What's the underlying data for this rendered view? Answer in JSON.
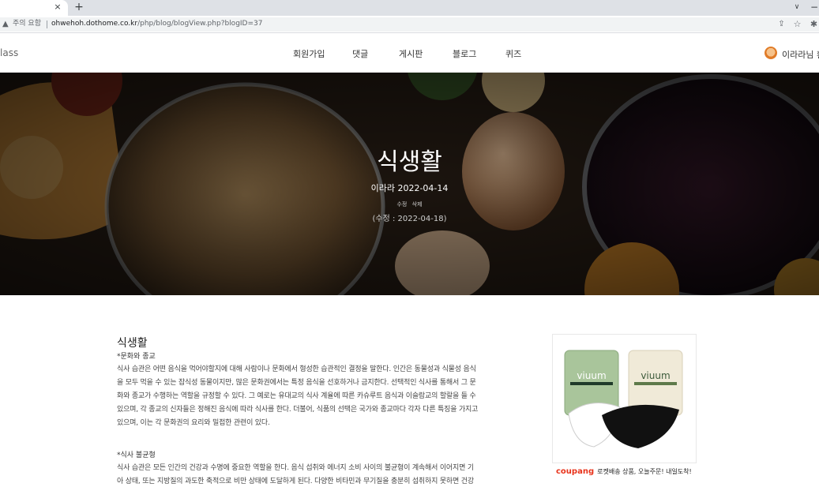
{
  "browser": {
    "tab_close": "×",
    "new_tab": "+",
    "tab_dropdown": "∨",
    "window_min": "−",
    "security_warning": "주의 요함",
    "url_host": "ohwehoh.dothome.co.kr",
    "url_path": "/php/blog/blogView.php?blogID=37",
    "icons": [
      "warning-icon",
      "share-icon",
      "star-icon",
      "extension-icon"
    ]
  },
  "site": {
    "logo_text": "lass",
    "menu": [
      "회원가입",
      "댓글",
      "게시판",
      "블로그",
      "퀴즈"
    ],
    "user_label": "이라라님 환"
  },
  "hero": {
    "title": "식생활",
    "author_date": "이라라 2022-04-14",
    "action_edit": "수정",
    "action_delete": "삭제",
    "edited": "(수정 : 2022-04-18)"
  },
  "article": {
    "title": "식생활",
    "section1_head": "*문화와 종교",
    "section1_lines": [
      "식사 습관은 어떤 음식을 먹어야할지에 대해 사람이나 문화에서 형성한 습관적인 결정을 말한다. 인간은 동물성과 식물성 음식",
      "을 모두 먹을 수 있는 잡식성 동물이지만, 많은 문화권에서는 특정 음식을 선호하거나 금지한다. 선택적인 식사를 통해서 그 문",
      "화와 종교가 수행하는 역할을 규정할 수 있다. 그 예로는 유대교의 식사 계율에 따른 카슈루트 음식과 이슬람교의 할랄을 들 수",
      "있으며, 각 종교의 신자들은 정해진 음식에 따라 식사를 한다. 더불어, 식품의 선택은 국가와 종교마다 각자 다른 특징을 가지고",
      "있으며, 이는 각 문화권의 요리와 밀접한 관련이 있다."
    ],
    "section2_head": "*식사 불균형",
    "section2_lines": [
      "식사 습관은 모든 인간의 건강과 수명에 중요한 역할을 한다. 음식 섭취와 에너지 소비 사이의 불균형이 계속해서 이어지면 기",
      "아 상태, 또는 지방질의 과도한 축적으로 비만 상태에 도달하게 된다. 다양한 비타민과 무기질을 충분히 섭취하지 못하면 건강"
    ]
  },
  "ad": {
    "brand": "coupang",
    "tagline": "로켓배송 상품, 오늘주문! 내일도착!",
    "product_label": "viuum"
  }
}
